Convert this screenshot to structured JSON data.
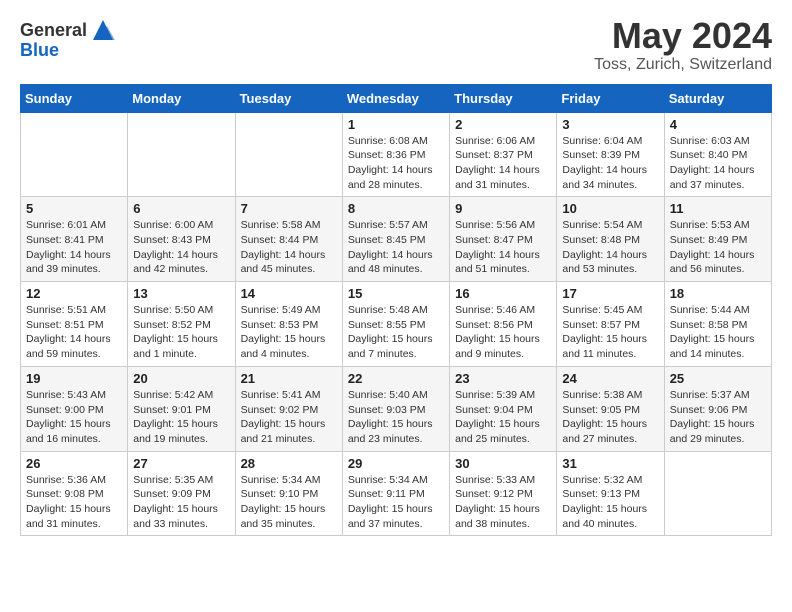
{
  "logo": {
    "general": "General",
    "blue": "Blue"
  },
  "title": "May 2024",
  "subtitle": "Toss, Zurich, Switzerland",
  "weekdays": [
    "Sunday",
    "Monday",
    "Tuesday",
    "Wednesday",
    "Thursday",
    "Friday",
    "Saturday"
  ],
  "weeks": [
    [
      {
        "day": "",
        "info": ""
      },
      {
        "day": "",
        "info": ""
      },
      {
        "day": "",
        "info": ""
      },
      {
        "day": "1",
        "info": "Sunrise: 6:08 AM\nSunset: 8:36 PM\nDaylight: 14 hours\nand 28 minutes."
      },
      {
        "day": "2",
        "info": "Sunrise: 6:06 AM\nSunset: 8:37 PM\nDaylight: 14 hours\nand 31 minutes."
      },
      {
        "day": "3",
        "info": "Sunrise: 6:04 AM\nSunset: 8:39 PM\nDaylight: 14 hours\nand 34 minutes."
      },
      {
        "day": "4",
        "info": "Sunrise: 6:03 AM\nSunset: 8:40 PM\nDaylight: 14 hours\nand 37 minutes."
      }
    ],
    [
      {
        "day": "5",
        "info": "Sunrise: 6:01 AM\nSunset: 8:41 PM\nDaylight: 14 hours\nand 39 minutes."
      },
      {
        "day": "6",
        "info": "Sunrise: 6:00 AM\nSunset: 8:43 PM\nDaylight: 14 hours\nand 42 minutes."
      },
      {
        "day": "7",
        "info": "Sunrise: 5:58 AM\nSunset: 8:44 PM\nDaylight: 14 hours\nand 45 minutes."
      },
      {
        "day": "8",
        "info": "Sunrise: 5:57 AM\nSunset: 8:45 PM\nDaylight: 14 hours\nand 48 minutes."
      },
      {
        "day": "9",
        "info": "Sunrise: 5:56 AM\nSunset: 8:47 PM\nDaylight: 14 hours\nand 51 minutes."
      },
      {
        "day": "10",
        "info": "Sunrise: 5:54 AM\nSunset: 8:48 PM\nDaylight: 14 hours\nand 53 minutes."
      },
      {
        "day": "11",
        "info": "Sunrise: 5:53 AM\nSunset: 8:49 PM\nDaylight: 14 hours\nand 56 minutes."
      }
    ],
    [
      {
        "day": "12",
        "info": "Sunrise: 5:51 AM\nSunset: 8:51 PM\nDaylight: 14 hours\nand 59 minutes."
      },
      {
        "day": "13",
        "info": "Sunrise: 5:50 AM\nSunset: 8:52 PM\nDaylight: 15 hours\nand 1 minute."
      },
      {
        "day": "14",
        "info": "Sunrise: 5:49 AM\nSunset: 8:53 PM\nDaylight: 15 hours\nand 4 minutes."
      },
      {
        "day": "15",
        "info": "Sunrise: 5:48 AM\nSunset: 8:55 PM\nDaylight: 15 hours\nand 7 minutes."
      },
      {
        "day": "16",
        "info": "Sunrise: 5:46 AM\nSunset: 8:56 PM\nDaylight: 15 hours\nand 9 minutes."
      },
      {
        "day": "17",
        "info": "Sunrise: 5:45 AM\nSunset: 8:57 PM\nDaylight: 15 hours\nand 11 minutes."
      },
      {
        "day": "18",
        "info": "Sunrise: 5:44 AM\nSunset: 8:58 PM\nDaylight: 15 hours\nand 14 minutes."
      }
    ],
    [
      {
        "day": "19",
        "info": "Sunrise: 5:43 AM\nSunset: 9:00 PM\nDaylight: 15 hours\nand 16 minutes."
      },
      {
        "day": "20",
        "info": "Sunrise: 5:42 AM\nSunset: 9:01 PM\nDaylight: 15 hours\nand 19 minutes."
      },
      {
        "day": "21",
        "info": "Sunrise: 5:41 AM\nSunset: 9:02 PM\nDaylight: 15 hours\nand 21 minutes."
      },
      {
        "day": "22",
        "info": "Sunrise: 5:40 AM\nSunset: 9:03 PM\nDaylight: 15 hours\nand 23 minutes."
      },
      {
        "day": "23",
        "info": "Sunrise: 5:39 AM\nSunset: 9:04 PM\nDaylight: 15 hours\nand 25 minutes."
      },
      {
        "day": "24",
        "info": "Sunrise: 5:38 AM\nSunset: 9:05 PM\nDaylight: 15 hours\nand 27 minutes."
      },
      {
        "day": "25",
        "info": "Sunrise: 5:37 AM\nSunset: 9:06 PM\nDaylight: 15 hours\nand 29 minutes."
      }
    ],
    [
      {
        "day": "26",
        "info": "Sunrise: 5:36 AM\nSunset: 9:08 PM\nDaylight: 15 hours\nand 31 minutes."
      },
      {
        "day": "27",
        "info": "Sunrise: 5:35 AM\nSunset: 9:09 PM\nDaylight: 15 hours\nand 33 minutes."
      },
      {
        "day": "28",
        "info": "Sunrise: 5:34 AM\nSunset: 9:10 PM\nDaylight: 15 hours\nand 35 minutes."
      },
      {
        "day": "29",
        "info": "Sunrise: 5:34 AM\nSunset: 9:11 PM\nDaylight: 15 hours\nand 37 minutes."
      },
      {
        "day": "30",
        "info": "Sunrise: 5:33 AM\nSunset: 9:12 PM\nDaylight: 15 hours\nand 38 minutes."
      },
      {
        "day": "31",
        "info": "Sunrise: 5:32 AM\nSunset: 9:13 PM\nDaylight: 15 hours\nand 40 minutes."
      },
      {
        "day": "",
        "info": ""
      }
    ]
  ]
}
